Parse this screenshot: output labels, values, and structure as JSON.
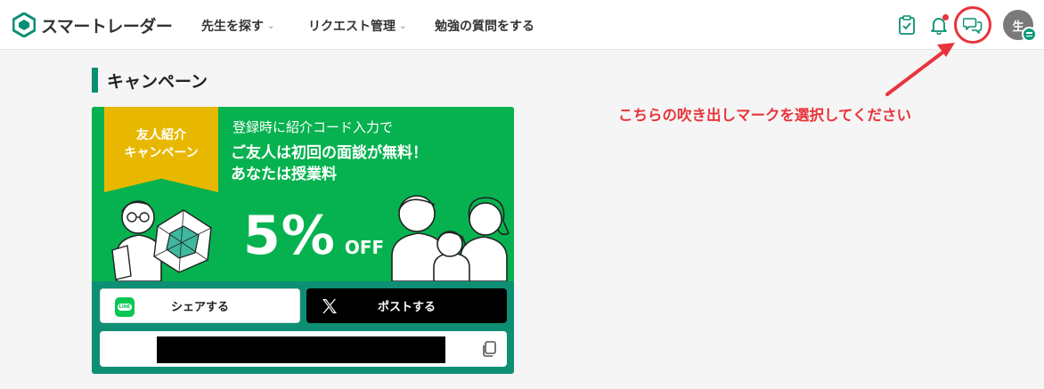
{
  "header": {
    "logo_text": "スマートレーダー",
    "nav": [
      {
        "label": "先生を探す",
        "has_dropdown": true
      },
      {
        "label": "リクエスト管理",
        "has_dropdown": true
      },
      {
        "label": "勉強の質問をする",
        "has_dropdown": false
      }
    ],
    "icons": [
      "clipboard-check-icon",
      "bell-icon",
      "chat-bubbles-icon"
    ],
    "avatar_initial": "生"
  },
  "section": {
    "title": "キャンペーン"
  },
  "campaign": {
    "ribbon_line1": "友人紹介",
    "ribbon_line2": "キャンペーン",
    "subtitle": "登録時に紹介コード入力で",
    "headline_line1": "ご友人は初回の面談が無料！",
    "headline_line2": "あなたは授業料",
    "discount": "5%",
    "discount_suffix": "OFF",
    "line_share_label": "シェアする",
    "x_post_label": "ポストする",
    "line_icon_text": "LINE"
  },
  "annotation": {
    "text": "こちらの吹き出しマークを選択してください"
  },
  "colors": {
    "brand_green": "#0a8f73",
    "banner_green": "#06b24f",
    "ribbon_yellow": "#e8b800",
    "annotation_red": "#e8343c"
  }
}
